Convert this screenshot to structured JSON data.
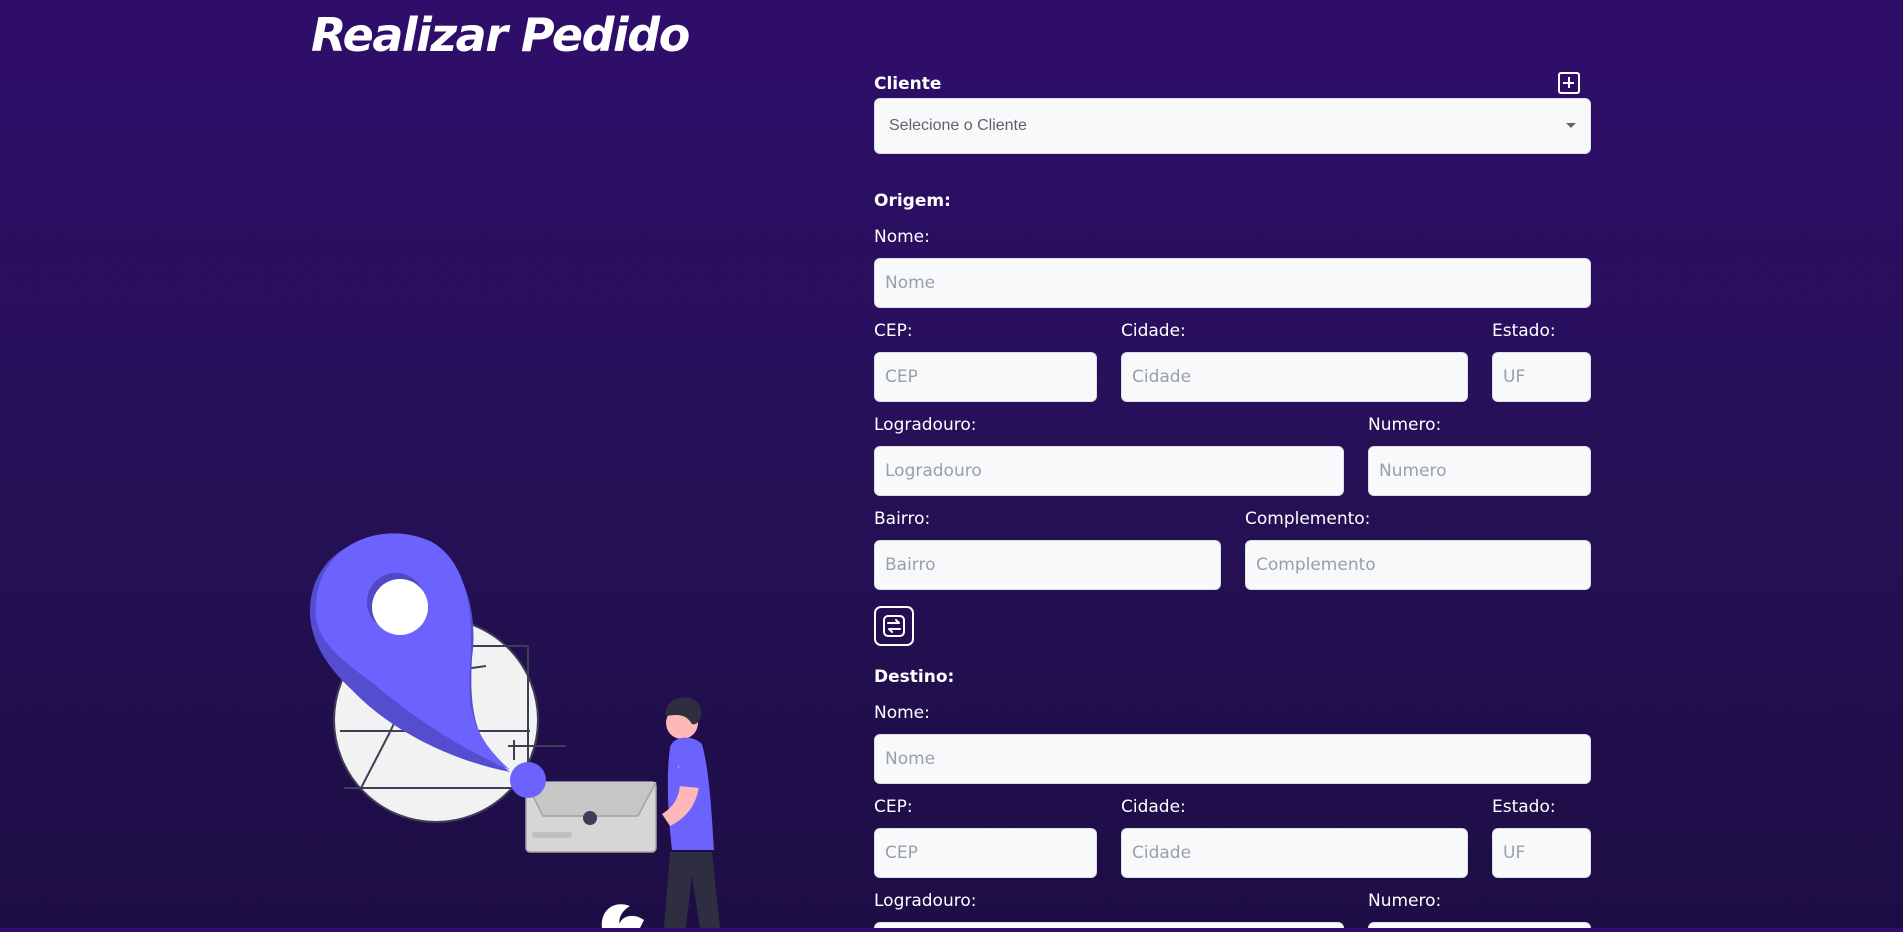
{
  "page": {
    "title": "Realizar Pedido"
  },
  "cliente": {
    "label": "Cliente",
    "select_placeholder": "Selecione o Cliente",
    "add_icon": "plus-square-icon"
  },
  "origem": {
    "heading": "Origem:",
    "nome_label": "Nome:",
    "nome_placeholder": "Nome",
    "cep_label": "CEP:",
    "cep_placeholder": "CEP",
    "cidade_label": "Cidade:",
    "cidade_placeholder": "Cidade",
    "estado_label": "Estado:",
    "estado_placeholder": "UF",
    "logradouro_label": "Logradouro:",
    "logradouro_placeholder": "Logradouro",
    "numero_label": "Numero:",
    "numero_placeholder": "Numero",
    "bairro_label": "Bairro:",
    "bairro_placeholder": "Bairro",
    "complemento_label": "Complemento:",
    "complemento_placeholder": "Complemento"
  },
  "swap": {
    "icon": "swap-arrows-icon"
  },
  "destino": {
    "heading": "Destino:",
    "nome_label": "Nome:",
    "nome_placeholder": "Nome",
    "cep_label": "CEP:",
    "cep_placeholder": "CEP",
    "cidade_label": "Cidade:",
    "cidade_placeholder": "Cidade",
    "estado_label": "Estado:",
    "estado_placeholder": "UF",
    "logradouro_label": "Logradouro:",
    "numero_label": "Numero:"
  },
  "colors": {
    "background_top": "#2f0e6b",
    "background_bottom": "#1d0d45",
    "accent_purple": "#6c63ff",
    "input_background": "#f8f9fb"
  }
}
